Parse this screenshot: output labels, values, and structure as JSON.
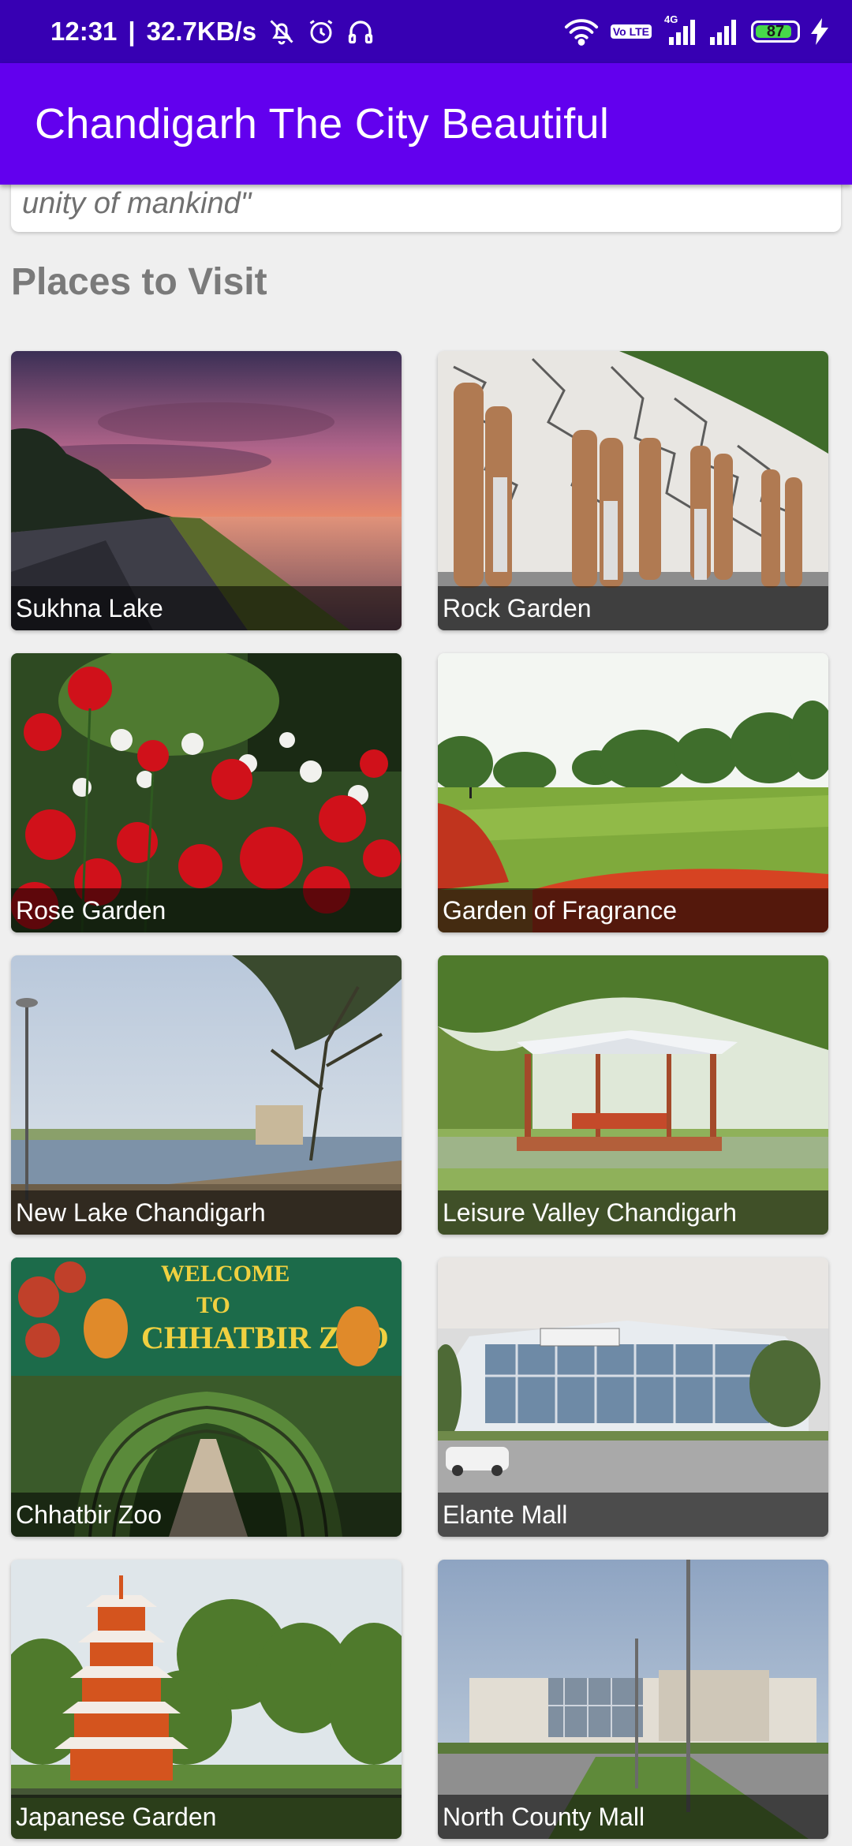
{
  "status_bar": {
    "time": "12:31",
    "separator": "|",
    "network_speed": "32.7KB/s",
    "battery_level": "87",
    "icons": [
      "mute-icon",
      "alarm-icon",
      "headphones-icon",
      "wifi-icon",
      "volte-icon",
      "signal-4g-icon",
      "signal-icon",
      "battery-icon",
      "charging-icon"
    ],
    "volte_label": "Vo LTE",
    "network_type": "4G"
  },
  "app_bar": {
    "title": "Chandigarh The City Beautiful"
  },
  "intro_card": {
    "quote_fragment": "unity of mankind\""
  },
  "section": {
    "title": "Places to Visit"
  },
  "places": [
    {
      "name": "Sukhna Lake"
    },
    {
      "name": "Rock Garden"
    },
    {
      "name": "Rose Garden"
    },
    {
      "name": "Garden of Fragrance"
    },
    {
      "name": "New Lake Chandigarh"
    },
    {
      "name": "Leisure Valley Chandigarh"
    },
    {
      "name": "Chhatbir Zoo"
    },
    {
      "name": "Elante Mall"
    },
    {
      "name": "Japanese Garden"
    },
    {
      "name": "North County Mall"
    }
  ],
  "colors": {
    "status_bar": "#3700b3",
    "app_bar": "#6200ee",
    "background": "#efefef",
    "section_title": "#7a7a7a"
  }
}
